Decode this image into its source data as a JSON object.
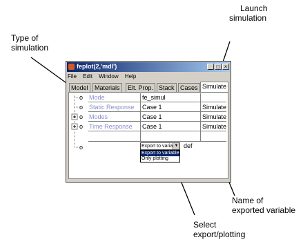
{
  "callouts": {
    "type_of_simulation": [
      "Type of",
      "simulation"
    ],
    "launch_simulation": [
      "Launch",
      "simulation"
    ],
    "name_exported": [
      "Name of",
      "exported variable"
    ],
    "select_export": [
      "Select",
      "export/plotting"
    ]
  },
  "window": {
    "title": "feplot(2,'mdl')",
    "minimize_glyph": "_",
    "maximize_glyph": "□",
    "close_glyph": "×"
  },
  "menu": [
    "File",
    "Edit",
    "Window",
    "Help"
  ],
  "tabs": [
    "Model",
    "Materials",
    "Elt. Prop.",
    "Stack",
    "Cases",
    "Simulate"
  ],
  "active_tab": "Simulate",
  "rows": [
    {
      "tree": "o",
      "label": "Mode",
      "value": "fe_simul",
      "action": ""
    },
    {
      "tree": "o",
      "label": "Static Response",
      "value": "Case 1",
      "action": "Simulate"
    },
    {
      "tree": "o",
      "label": "Modes",
      "value": "Case 1",
      "action": "Simulate"
    },
    {
      "tree": "o",
      "label": "Time Response",
      "value": "Case 1",
      "action": "Simulate"
    },
    {
      "tree": "o",
      "label": "",
      "value": "Export to variable",
      "action": "def"
    }
  ],
  "dropdown": {
    "selected": "Export to variable",
    "arrow": "▼",
    "options": [
      "Export to variable",
      "Only plotting"
    ]
  }
}
